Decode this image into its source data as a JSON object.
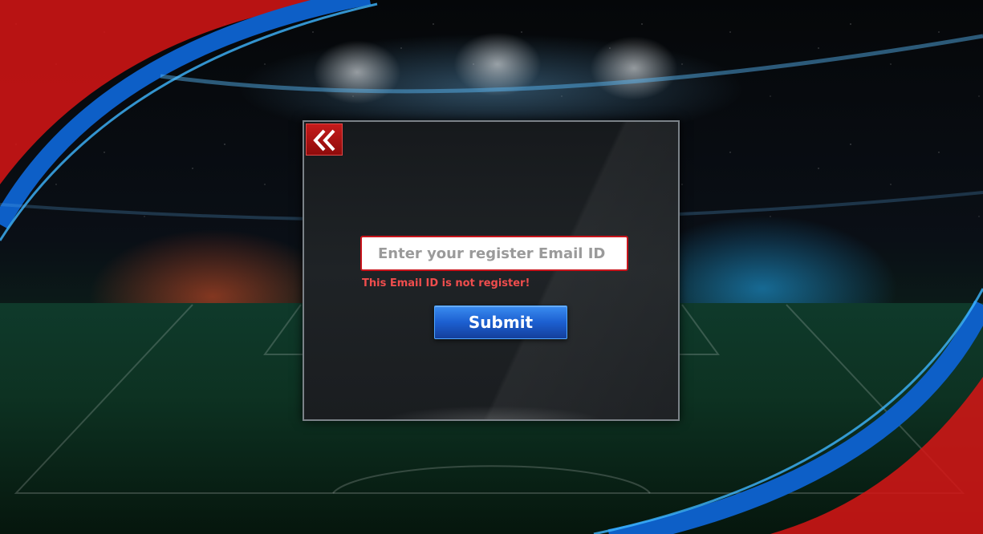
{
  "dialog": {
    "back_icon": "double-chevron-left-icon",
    "email_placeholder": "Enter your register Email ID",
    "email_value": "",
    "error_message": "This Email ID is not register!",
    "submit_label": "Submit"
  },
  "colors": {
    "back_button": "#b01515",
    "field_border": "#c8141b",
    "error_text": "#ef4d4d",
    "submit_button": "#1c5fd0",
    "ribbon_red": "#d81515",
    "ribbon_blue": "#0d5fc7"
  }
}
